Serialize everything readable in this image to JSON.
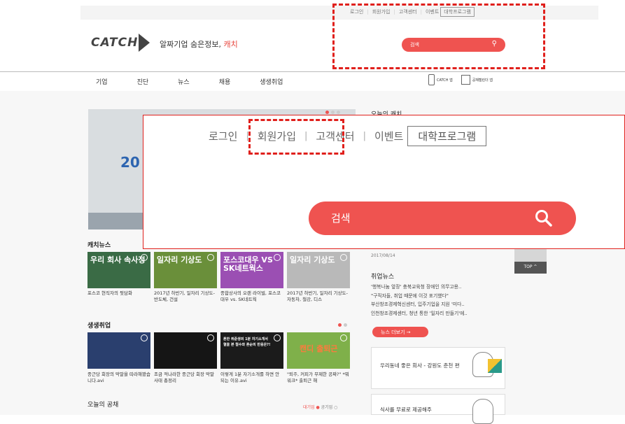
{
  "util_nav": {
    "login": "로그인",
    "signup": "회원가입",
    "support": "고객센터",
    "event": "이벤트",
    "university": "대학프로그램"
  },
  "logo": {
    "text": "CATCH"
  },
  "tagline": {
    "prefix": "알짜기업 숨은정보,",
    "brand": "캐치"
  },
  "search": {
    "placeholder": "검색",
    "icon": "search-icon"
  },
  "gnb": {
    "items": [
      "기업",
      "진단",
      "뉴스",
      "채용",
      "생생취업"
    ]
  },
  "apps": {
    "catch_app": "CATCH 앱",
    "calendar_app": "공채캘린더 앱"
  },
  "banner": {
    "text": "20"
  },
  "todays_catch": {
    "title": "오늘의 캐치"
  },
  "catch_news": {
    "title": "캐치뉴스",
    "thumbs": [
      {
        "text": "우리 회사 속사정",
        "bg": "#3a6b45"
      },
      {
        "text": "일자리 기상도",
        "bg": "#6a8f3a"
      },
      {
        "text": "포스코대우 VS SK네트웍스",
        "bg": "#9b4fb3"
      },
      {
        "text": "일자리 기상도",
        "bg": "#b9b9b9"
      }
    ],
    "captions": [
      "포스코 현직자의 뒷담화",
      "2017년 하반기, 일자리 기상도-반도체, 건설",
      "종합상사의 오랜 라이벌, 포스코대우 vs. SK네트웍",
      "2017년 하반기, 일자리 기상도-자동차, 철강, 디스"
    ]
  },
  "live_jobs": {
    "title": "생생취업",
    "thumbs": [
      {
        "text": "",
        "bg": "#2a3f6e"
      },
      {
        "text": "",
        "bg": "#151515"
      },
      {
        "text": "흔한 취준생의 1분 자기소개서 혈을 본 철수와 흔순의 반응은?!",
        "bg": "#1b1b1b"
      },
      {
        "text": "캔디 출퇴근",
        "bg": "#7fb04a"
      }
    ],
    "captions": [
      "종근당 회장의 막말을 따라해봤습니다.avi",
      "조금 적나라한 종근당 회장 막말 사태 총정리",
      "이렇게 1분 자기소개를 하면 안되는 이유.avi",
      "\"퇴주, 커피가 무제한 공짜?\" *뭐워크* 출퇴근 해"
    ]
  },
  "right": {
    "date": "2017/08/14",
    "top_label": "TOP ^",
    "job_news_title": "취업뉴스",
    "job_news": [
      "'행복나눔 앞장' 충북교육청 장애인 의무고용..",
      "\"구직자들, 취업 때문에 이것 포기했다\"",
      "부산창조경제혁신센터, 입주기업을 지원 '미다..",
      "인천창조경제센터, 청년 통한 '일자리 만들기'에.."
    ],
    "more": "뉴스 더보기 →",
    "card1": "우리동네 좋은 회사 - 강원도 춘천 편",
    "card2": "식사를 무료로 제공해주"
  },
  "gongchae": {
    "title": "오늘의 공채",
    "big": "대기업 ●",
    "public": "공기업 ○"
  },
  "colors": {
    "accent": "#ef5350",
    "highlight": "#e0201c"
  }
}
